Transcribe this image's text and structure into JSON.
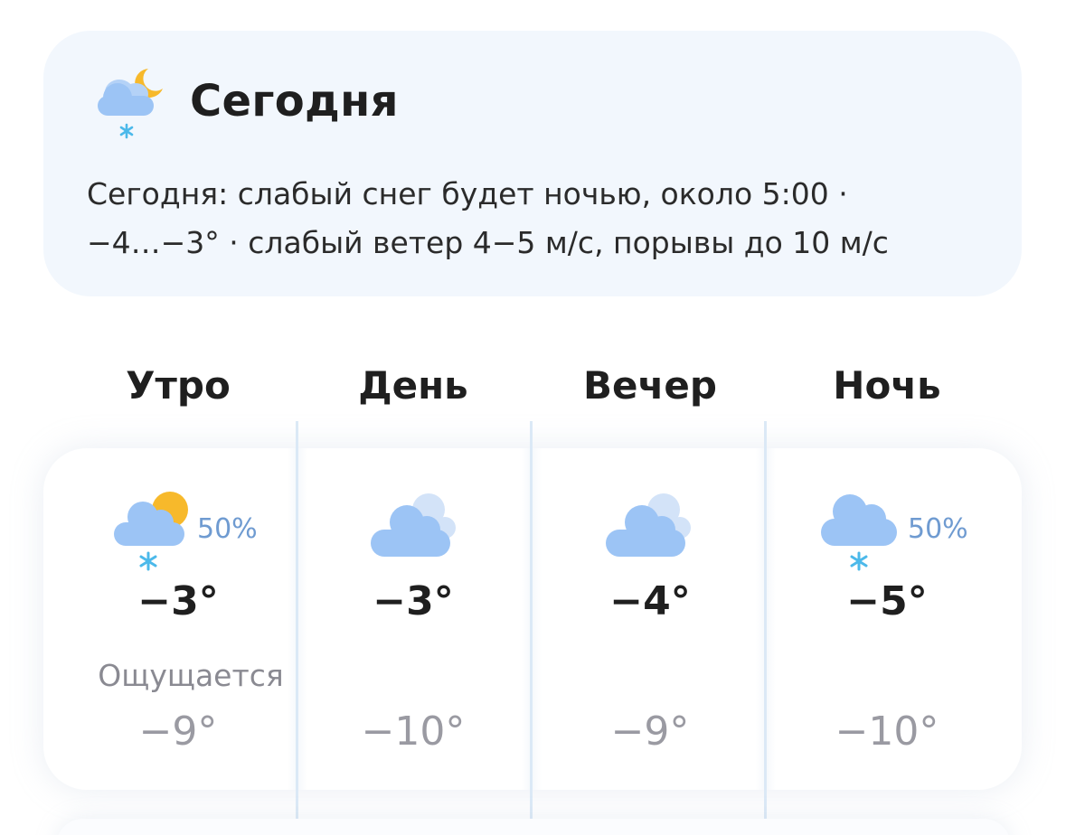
{
  "today": {
    "title": "Сегодня",
    "icon": "cloud-moon-snow-icon",
    "description_line1": "Сегодня: слабый снег будет ночью, около 5:00 ·",
    "description_line2": "−4…−3° · слабый ветер 4−5 м/с, порывы до 10 м/с"
  },
  "periods": [
    {
      "name": "Утро",
      "icon": "cloud-sun-snow-icon",
      "precipitation": "50%",
      "temp": "−3°",
      "feels_label": "Ощущается",
      "feels": "−9°"
    },
    {
      "name": "День",
      "icon": "cloudy-icon",
      "precipitation": "",
      "temp": "−3°",
      "feels": "−10°"
    },
    {
      "name": "Вечер",
      "icon": "cloudy-icon",
      "precipitation": "",
      "temp": "−4°",
      "feels": "−9°"
    },
    {
      "name": "Ночь",
      "icon": "cloud-snow-icon",
      "precipitation": "50%",
      "temp": "−5°",
      "feels": "−10°"
    }
  ],
  "colors": {
    "card_background": "#f2f7fd",
    "cloud": "#9cc4f5",
    "cloud_light": "#d3e3f8",
    "sun": "#f7b92b",
    "snowflake": "#4cb9ea",
    "precipitation_text": "#6f9bd1",
    "secondary_text": "#9a9aa2"
  }
}
